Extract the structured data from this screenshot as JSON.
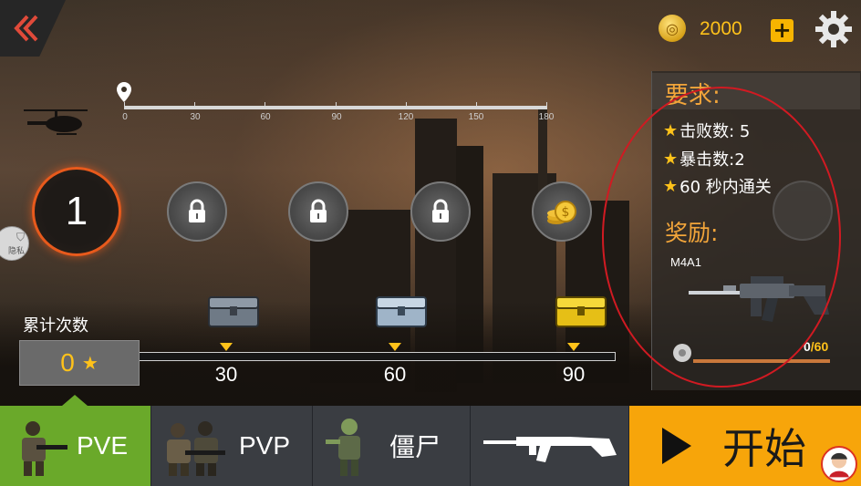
{
  "header": {
    "coins": "2000",
    "add_label": "+"
  },
  "ruler": {
    "ticks": [
      "0",
      "30",
      "60",
      "90",
      "120",
      "150",
      "180"
    ]
  },
  "levels": {
    "current": "1"
  },
  "privacy_label": "隐私",
  "cumulative": {
    "label": "累计次数",
    "count": "0",
    "milestones": [
      "30",
      "60",
      "90"
    ]
  },
  "requirements": {
    "title": "要求:",
    "items": [
      "击败数: 5",
      "暴击数:2",
      "60 秒内通关"
    ]
  },
  "reward": {
    "title": "奖励:",
    "name": "M4A1",
    "progress_current": "0",
    "progress_max": "/60"
  },
  "tabs": {
    "pve": "PVE",
    "pvp": "PVP",
    "zombie": "僵尸"
  },
  "start_label": "开始",
  "colors": {
    "accent_orange": "#f7a50a",
    "active_tab_green": "#6aa92a",
    "gold": "#ffc21a",
    "annotation_red": "#d11a22"
  }
}
